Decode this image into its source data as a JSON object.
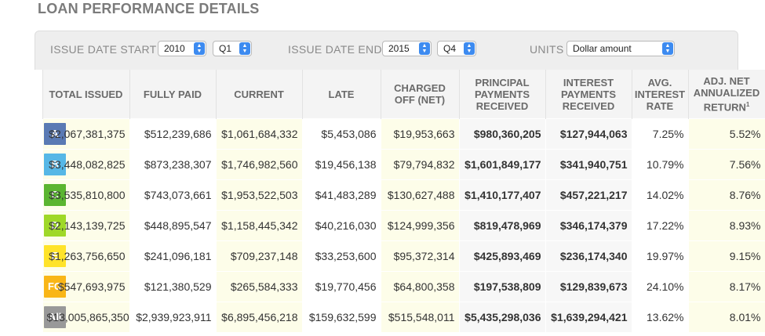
{
  "title": "LOAN PERFORMANCE DETAILS",
  "filters": {
    "start_label": "ISSUE DATE START",
    "start_year": "2010",
    "start_quarter": "Q1",
    "end_label": "ISSUE DATE END",
    "end_year": "2015",
    "end_quarter": "Q4",
    "units_label": "UNITS",
    "units_value": "Dollar amount"
  },
  "table": {
    "headers": [
      "TOTAL ISSUED",
      "FULLY PAID",
      "CURRENT",
      "LATE",
      "CHARGED OFF (NET)",
      "PRINCIPAL PAYMENTS RECEIVED",
      "INTEREST PAYMENTS RECEIVED",
      "AVG. INTEREST RATE",
      "ADJ. NET ANNUALIZED RETURN"
    ],
    "footnote_mark": "1",
    "rows": [
      {
        "grade": "A",
        "color": "#5a7ab4",
        "cells": [
          "$2,067,381,375",
          "$512,239,686",
          "$1,061,684,332",
          "$5,453,086",
          "$19,953,663",
          "$980,360,205",
          "$127,944,063",
          "7.25%",
          "5.52%"
        ]
      },
      {
        "grade": "B",
        "color": "#56b7e6",
        "cells": [
          "$3,448,082,825",
          "$873,238,307",
          "$1,746,982,560",
          "$19,456,138",
          "$79,794,832",
          "$1,601,849,177",
          "$341,940,751",
          "10.79%",
          "7.56%"
        ]
      },
      {
        "grade": "C",
        "color": "#5bb531",
        "cells": [
          "$3,535,810,800",
          "$743,073,661",
          "$1,953,522,503",
          "$41,483,289",
          "$130,627,488",
          "$1,410,177,407",
          "$457,221,217",
          "14.02%",
          "8.76%"
        ]
      },
      {
        "grade": "D",
        "color": "#9fd828",
        "cells": [
          "$2,143,139,725",
          "$448,895,547",
          "$1,158,445,342",
          "$40,216,030",
          "$124,999,356",
          "$819,478,969",
          "$346,174,379",
          "17.22%",
          "8.93%"
        ]
      },
      {
        "grade": "E",
        "color": "#ffe32a",
        "cells": [
          "$1,263,756,650",
          "$241,096,181",
          "$709,237,148",
          "$33,253,600",
          "$95,372,314",
          "$425,893,469",
          "$236,174,340",
          "19.97%",
          "9.15%"
        ]
      },
      {
        "grade": "FG",
        "color": "#f9b617",
        "cells": [
          "$547,693,975",
          "$121,380,529",
          "$265,584,333",
          "$19,770,456",
          "$64,800,358",
          "$197,538,809",
          "$129,839,673",
          "24.10%",
          "8.17%"
        ]
      },
      {
        "grade": "All",
        "color": "#999999",
        "cells": [
          "$13,005,865,350",
          "$2,939,923,911",
          "$6,895,456,218",
          "$159,632,599",
          "$515,548,011",
          "$5,435,298,036",
          "$1,639,294,421",
          "13.62%",
          "8.01%"
        ]
      }
    ]
  }
}
